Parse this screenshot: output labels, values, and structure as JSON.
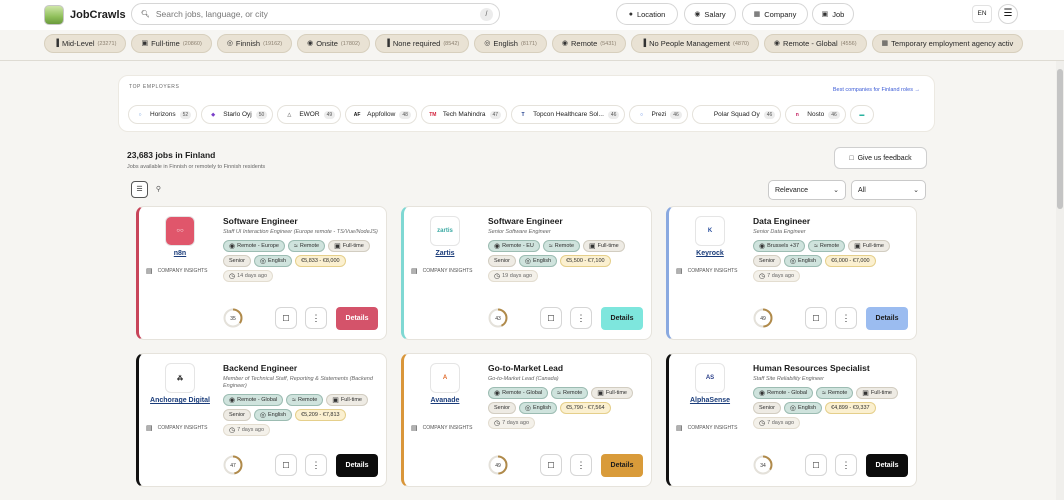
{
  "header": {
    "brand": "JobCrawls",
    "search_placeholder": "Search jobs, language, or city",
    "slash_key": "/",
    "buttons": {
      "location": "Location",
      "salary": "Salary",
      "company": "Company",
      "job": "Job"
    },
    "lang": "EN"
  },
  "chips": [
    {
      "label": "Mid-Level",
      "count": "(23271)",
      "icon": "bar-chart-icon"
    },
    {
      "label": "Full-time",
      "count": "(20860)",
      "icon": "briefcase-icon"
    },
    {
      "label": "Finnish",
      "count": "(19162)",
      "icon": "globe-icon"
    },
    {
      "label": "Onsite",
      "count": "(17802)",
      "icon": "pin-icon"
    },
    {
      "label": "None required",
      "count": "(8542)",
      "icon": "bar-chart-icon"
    },
    {
      "label": "English",
      "count": "(8171)",
      "icon": "globe-icon"
    },
    {
      "label": "Remote",
      "count": "(5431)",
      "icon": "pin-icon"
    },
    {
      "label": "No People Management",
      "count": "(4870)",
      "icon": "bar-chart-icon"
    },
    {
      "label": "Remote - Global",
      "count": "(4556)",
      "icon": "pin-icon"
    },
    {
      "label": "Temporary employment agency activ",
      "count": "",
      "icon": "building-icon"
    }
  ],
  "top_employers": {
    "title": "TOP EMPLOYERS",
    "link": "Best companies for Finland roles →",
    "items": [
      {
        "name": "Horizons",
        "count": "52",
        "logo": "○",
        "color": "#5a8fd8"
      },
      {
        "name": "Starlo Oyj",
        "count": "50",
        "logo": "◆",
        "color": "#7a3fc9"
      },
      {
        "name": "EWOR",
        "count": "49",
        "logo": "△",
        "color": "#888888"
      },
      {
        "name": "Appfollow",
        "count": "48",
        "logo": "AF",
        "color": "#111111"
      },
      {
        "name": "Tech Mahindra",
        "count": "47",
        "logo": "TM",
        "color": "#d2233c"
      },
      {
        "name": "Topcon Healthcare Sol...",
        "count": "46",
        "logo": "T",
        "color": "#1b3b8a"
      },
      {
        "name": "Prezi",
        "count": "46",
        "logo": "○",
        "color": "#3b6fe0"
      },
      {
        "name": "Polar Squad Oy",
        "count": "46",
        "logo": "",
        "color": "#aaaaaa"
      },
      {
        "name": "Nosto",
        "count": "46",
        "logo": "n",
        "color": "#c2185b"
      },
      {
        "name": "",
        "count": "",
        "logo": "▬",
        "color": "#2bb3a0"
      }
    ]
  },
  "jobs": {
    "count_title": "23,683 jobs in Finland",
    "subtitle": "Jobs available in Finnish or remotely to Finnish residents",
    "feedback": "Give us feedback",
    "sort": "Relevance",
    "filter": "All"
  },
  "cards": [
    {
      "company": "n8n",
      "title": "Software Engineer",
      "subtitle": "Staff UI Interaction Engineer (Europe remote - TS/Vue/NodeJS)",
      "insights": "COMPANY INSIGHTS",
      "tags": [
        {
          "t": "Remote - Europe",
          "k": "green",
          "i": "pin"
        },
        {
          "t": "Remote",
          "k": "green",
          "i": "wifi"
        },
        {
          "t": "Full-time",
          "k": "gray",
          "i": "case"
        },
        {
          "t": "Senior",
          "k": "gray",
          "i": ""
        },
        {
          "t": "English",
          "k": "green",
          "i": "globe"
        },
        {
          "t": "€5,833 - €8,000",
          "k": "sal",
          "i": ""
        },
        {
          "t": "14 days ago",
          "k": "age",
          "i": "clock"
        }
      ],
      "score": "35",
      "details": "Details"
    },
    {
      "company": "Zartis",
      "title": "Software Engineer",
      "subtitle": "Senior Software Engineer",
      "insights": "COMPANY INSIGHTS",
      "tags": [
        {
          "t": "Remote - EU",
          "k": "green",
          "i": "pin"
        },
        {
          "t": "Remote",
          "k": "green",
          "i": "wifi"
        },
        {
          "t": "Full-time",
          "k": "gray",
          "i": "case"
        },
        {
          "t": "Senior",
          "k": "gray",
          "i": ""
        },
        {
          "t": "English",
          "k": "green",
          "i": "globe"
        },
        {
          "t": "€5,500 - €7,100",
          "k": "sal",
          "i": ""
        },
        {
          "t": "19 days ago",
          "k": "age",
          "i": "clock"
        }
      ],
      "score": "43",
      "details": "Details"
    },
    {
      "company": "Keyrock",
      "title": "Data Engineer",
      "subtitle": "Senior Data Engineer",
      "insights": "COMPANY INSIGHTS",
      "tags": [
        {
          "t": "Brussels +37",
          "k": "green",
          "i": "pin"
        },
        {
          "t": "Remote",
          "k": "green",
          "i": "wifi"
        },
        {
          "t": "Full-time",
          "k": "gray",
          "i": "case"
        },
        {
          "t": "Senior",
          "k": "gray",
          "i": ""
        },
        {
          "t": "English",
          "k": "green",
          "i": "globe"
        },
        {
          "t": "€6,000 - €7,000",
          "k": "sal",
          "i": ""
        },
        {
          "t": "7 days ago",
          "k": "age",
          "i": "clock"
        }
      ],
      "score": "49",
      "details": "Details"
    },
    {
      "company": "Anchorage Digital",
      "title": "Backend Engineer",
      "subtitle": "Member of Technical Staff, Reporting & Statements (Backend Engineer)",
      "insights": "COMPANY INSIGHTS",
      "tags": [
        {
          "t": "Remote - Global",
          "k": "green",
          "i": "pin"
        },
        {
          "t": "Remote",
          "k": "green",
          "i": "wifi"
        },
        {
          "t": "Full-time",
          "k": "gray",
          "i": "case"
        },
        {
          "t": "Senior",
          "k": "gray",
          "i": ""
        },
        {
          "t": "English",
          "k": "green",
          "i": "globe"
        },
        {
          "t": "€5,209 - €7,813",
          "k": "sal",
          "i": ""
        },
        {
          "t": "7 days ago",
          "k": "age",
          "i": "clock"
        }
      ],
      "score": "47",
      "details": "Details"
    },
    {
      "company": "Avanade",
      "title": "Go-to-Market Lead",
      "subtitle": "Go-to-Market Lead (Canada)",
      "insights": "COMPANY INSIGHTS",
      "tags": [
        {
          "t": "Remote - Global",
          "k": "green",
          "i": "pin"
        },
        {
          "t": "Remote",
          "k": "green",
          "i": "wifi"
        },
        {
          "t": "Full-time",
          "k": "gray",
          "i": "case"
        },
        {
          "t": "Senior",
          "k": "gray",
          "i": ""
        },
        {
          "t": "English",
          "k": "green",
          "i": "globe"
        },
        {
          "t": "€5,790 - €7,564",
          "k": "sal",
          "i": ""
        },
        {
          "t": "7 days ago",
          "k": "age",
          "i": "clock"
        }
      ],
      "score": "49",
      "details": "Details"
    },
    {
      "company": "AlphaSense",
      "title": "Human Resources Specialist",
      "subtitle": "Staff Site Reliability Engineer",
      "insights": "COMPANY INSIGHTS",
      "tags": [
        {
          "t": "Remote - Global",
          "k": "green",
          "i": "pin"
        },
        {
          "t": "Remote",
          "k": "green",
          "i": "wifi"
        },
        {
          "t": "Full-time",
          "k": "gray",
          "i": "case"
        },
        {
          "t": "Senior",
          "k": "gray",
          "i": ""
        },
        {
          "t": "English",
          "k": "green",
          "i": "globe"
        },
        {
          "t": "€4,899 - €9,337",
          "k": "sal",
          "i": ""
        },
        {
          "t": "7 days ago",
          "k": "age",
          "i": "clock"
        }
      ],
      "score": "34",
      "details": "Details"
    }
  ],
  "card_colors": [
    {
      "accent": "#c8455a",
      "logo_bg": "#e0566b",
      "logo_fg": "#ffffff",
      "logo": "○○",
      "btn_bg": "#d4536a",
      "btn_fg": "#ffffff"
    },
    {
      "accent": "#7fd8d3",
      "logo_bg": "#ffffff",
      "logo_fg": "#3aa9a3",
      "logo": "zartis",
      "btn_bg": "#7ee6dd",
      "btn_fg": "#1c1c1c"
    },
    {
      "accent": "#8aa9e0",
      "logo_bg": "#ffffff",
      "logo_fg": "#2a4f9e",
      "logo": "K",
      "btn_bg": "#9bbcf0",
      "btn_fg": "#1c1c1c"
    },
    {
      "accent": "#111111",
      "logo_bg": "#ffffff",
      "logo_fg": "#111111",
      "logo": "⁂",
      "btn_bg": "#0c0c0c",
      "btn_fg": "#ffffff"
    },
    {
      "accent": "#d9963a",
      "logo_bg": "#ffffff",
      "logo_fg": "#e06a2a",
      "logo": "A",
      "btn_bg": "#d99b3a",
      "btn_fg": "#1c1c1c"
    },
    {
      "accent": "#111111",
      "logo_bg": "#ffffff",
      "logo_fg": "#2a3f8a",
      "logo": "AS",
      "btn_bg": "#0c0c0c",
      "btn_fg": "#ffffff"
    }
  ]
}
